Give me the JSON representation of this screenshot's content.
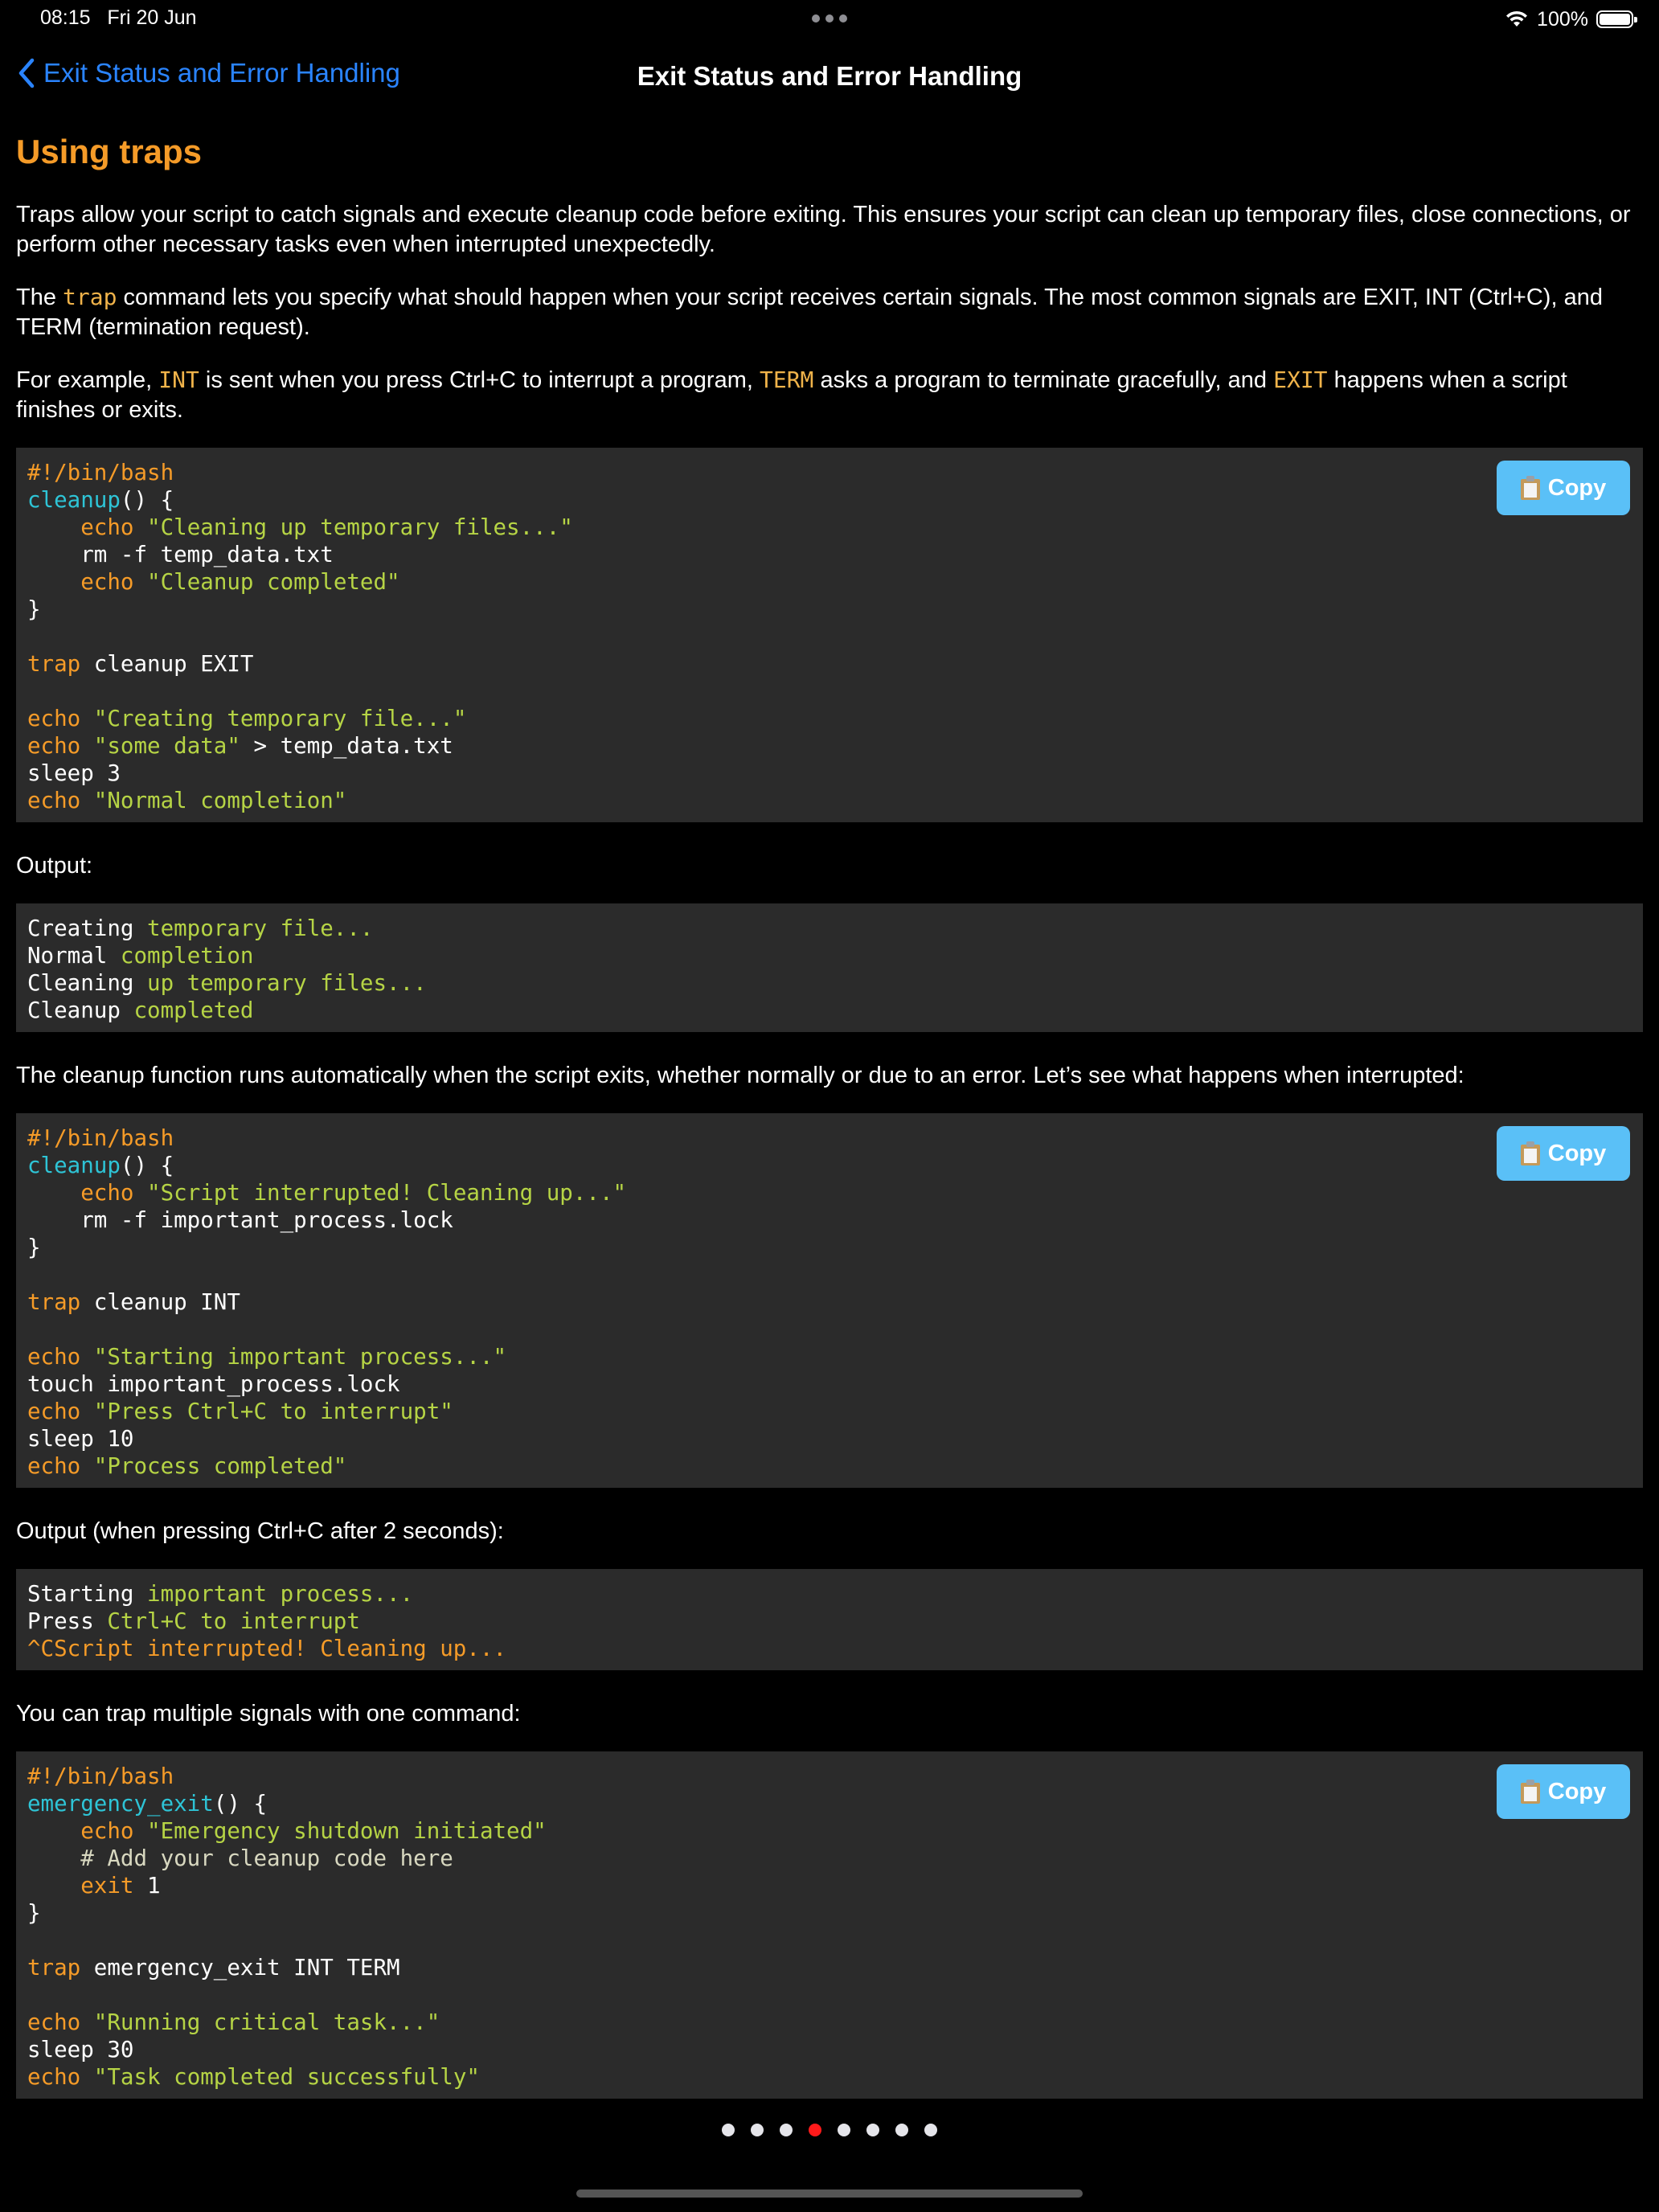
{
  "status_bar": {
    "time": "08:15",
    "date": "Fri 20 Jun",
    "battery": "100%",
    "battery_level": 1.0,
    "wifi_icon": "wifi-icon"
  },
  "nav": {
    "back_label": "Exit Status and Error Handling",
    "title": "Exit Status and Error Handling"
  },
  "content": {
    "section_title": "Using traps",
    "p1": "Traps allow your script to catch signals and execute cleanup code before exiting. This ensures your script can clean up temporary files, close connections, or perform other necessary tasks even when interrupted unexpectedly.",
    "p2": [
      {
        "text": "The ",
        "style": "plain"
      },
      {
        "text": "trap",
        "style": "kw"
      },
      {
        "text": " command lets you specify what should happen when your script receives certain signals. The most common signals are EXIT, INT (Ctrl+C), and TERM (termination request).",
        "style": "plain"
      }
    ],
    "p3": [
      {
        "text": "For example, ",
        "style": "plain"
      },
      {
        "text": "INT",
        "style": "kw"
      },
      {
        "text": " is sent when you press Ctrl+C to interrupt a program, ",
        "style": "plain"
      },
      {
        "text": "TERM",
        "style": "kw"
      },
      {
        "text": " asks a program to terminate gracefully, and ",
        "style": "plain"
      },
      {
        "text": "EXIT",
        "style": "kw"
      },
      {
        "text": " happens when a script finishes or exits.",
        "style": "plain"
      }
    ],
    "code1": [
      [
        {
          "t": "#!/bin/bash",
          "c": "orange"
        }
      ],
      [
        {
          "t": "cleanup",
          "c": "cyan"
        },
        {
          "t": "() {",
          "c": "white"
        }
      ],
      [
        {
          "t": "    ",
          "c": "white"
        },
        {
          "t": "echo",
          "c": "orange"
        },
        {
          "t": " ",
          "c": "white"
        },
        {
          "t": "\"Cleaning up temporary files...\"",
          "c": "green"
        }
      ],
      [
        {
          "t": "    rm -f temp_data.txt",
          "c": "white"
        }
      ],
      [
        {
          "t": "    ",
          "c": "white"
        },
        {
          "t": "echo",
          "c": "orange"
        },
        {
          "t": " ",
          "c": "white"
        },
        {
          "t": "\"Cleanup completed\"",
          "c": "green"
        }
      ],
      [
        {
          "t": "}",
          "c": "white"
        }
      ],
      [],
      [
        {
          "t": "trap",
          "c": "orange"
        },
        {
          "t": " cleanup EXIT",
          "c": "white"
        }
      ],
      [],
      [
        {
          "t": "echo",
          "c": "orange"
        },
        {
          "t": " ",
          "c": "white"
        },
        {
          "t": "\"Creating temporary file...\"",
          "c": "green"
        }
      ],
      [
        {
          "t": "echo",
          "c": "orange"
        },
        {
          "t": " ",
          "c": "white"
        },
        {
          "t": "\"some data\"",
          "c": "green"
        },
        {
          "t": " > temp_data.txt",
          "c": "white"
        }
      ],
      [
        {
          "t": "sleep 3",
          "c": "white"
        }
      ],
      [
        {
          "t": "echo",
          "c": "orange"
        },
        {
          "t": " ",
          "c": "white"
        },
        {
          "t": "\"Normal completion\"",
          "c": "green"
        }
      ]
    ],
    "output1_label": "Output:",
    "output1": [
      [
        {
          "t": "Creating ",
          "c": "white"
        },
        {
          "t": "temporary file...",
          "c": "green"
        }
      ],
      [
        {
          "t": "Normal ",
          "c": "white"
        },
        {
          "t": "completion",
          "c": "green"
        }
      ],
      [
        {
          "t": "Cleaning ",
          "c": "white"
        },
        {
          "t": "up temporary files...",
          "c": "green"
        }
      ],
      [
        {
          "t": "Cleanup ",
          "c": "white"
        },
        {
          "t": "completed",
          "c": "green"
        }
      ]
    ],
    "p4": "The cleanup function runs automatically when the script exits, whether normally or due to an error. Let’s see what happens when interrupted:",
    "code2": [
      [
        {
          "t": "#!/bin/bash",
          "c": "orange"
        }
      ],
      [
        {
          "t": "cleanup",
          "c": "cyan"
        },
        {
          "t": "() {",
          "c": "white"
        }
      ],
      [
        {
          "t": "    ",
          "c": "white"
        },
        {
          "t": "echo",
          "c": "orange"
        },
        {
          "t": " ",
          "c": "white"
        },
        {
          "t": "\"Script interrupted! Cleaning up...\"",
          "c": "green"
        }
      ],
      [
        {
          "t": "    rm -f important_process.lock",
          "c": "white"
        }
      ],
      [
        {
          "t": "}",
          "c": "white"
        }
      ],
      [],
      [
        {
          "t": "trap",
          "c": "orange"
        },
        {
          "t": " cleanup INT",
          "c": "white"
        }
      ],
      [],
      [
        {
          "t": "echo",
          "c": "orange"
        },
        {
          "t": " ",
          "c": "white"
        },
        {
          "t": "\"Starting important process...\"",
          "c": "green"
        }
      ],
      [
        {
          "t": "touch important_process.lock",
          "c": "white"
        }
      ],
      [
        {
          "t": "echo",
          "c": "orange"
        },
        {
          "t": " ",
          "c": "white"
        },
        {
          "t": "\"Press Ctrl+C to interrupt\"",
          "c": "green"
        }
      ],
      [
        {
          "t": "sleep 10",
          "c": "white"
        }
      ],
      [
        {
          "t": "echo",
          "c": "orange"
        },
        {
          "t": " ",
          "c": "white"
        },
        {
          "t": "\"Process completed\"",
          "c": "green"
        }
      ]
    ],
    "output2_label": "Output (when pressing Ctrl+C after 2 seconds):",
    "output2": [
      [
        {
          "t": "Starting ",
          "c": "white"
        },
        {
          "t": "important process...",
          "c": "green"
        }
      ],
      [
        {
          "t": "Press ",
          "c": "white"
        },
        {
          "t": "Ctrl+C to interrupt",
          "c": "green"
        }
      ],
      [
        {
          "t": "^CScript interrupted! Cleaning up...",
          "c": "orange"
        }
      ]
    ],
    "p5": "You can trap multiple signals with one command:",
    "code3": [
      [
        {
          "t": "#!/bin/bash",
          "c": "orange"
        }
      ],
      [
        {
          "t": "emergency_exit",
          "c": "cyan"
        },
        {
          "t": "() {",
          "c": "white"
        }
      ],
      [
        {
          "t": "    ",
          "c": "white"
        },
        {
          "t": "echo",
          "c": "orange"
        },
        {
          "t": " ",
          "c": "white"
        },
        {
          "t": "\"Emergency shutdown initiated\"",
          "c": "green"
        }
      ],
      [
        {
          "t": "    # Add your cleanup code here",
          "c": "comment"
        }
      ],
      [
        {
          "t": "    ",
          "c": "white"
        },
        {
          "t": "exit",
          "c": "orange"
        },
        {
          "t": " 1",
          "c": "white"
        }
      ],
      [
        {
          "t": "}",
          "c": "white"
        }
      ],
      [],
      [
        {
          "t": "trap",
          "c": "orange"
        },
        {
          "t": " emergency_exit INT TERM",
          "c": "white"
        }
      ],
      [],
      [
        {
          "t": "echo",
          "c": "orange"
        },
        {
          "t": " ",
          "c": "white"
        },
        {
          "t": "\"Running critical task...\"",
          "c": "green"
        }
      ],
      [
        {
          "t": "sleep 30",
          "c": "white"
        }
      ],
      [
        {
          "t": "echo",
          "c": "orange"
        },
        {
          "t": " ",
          "c": "white"
        },
        {
          "t": "\"Task completed successfully\"",
          "c": "green"
        }
      ]
    ],
    "copy_label": "Copy"
  },
  "pager": {
    "count": 8,
    "active_index": 3
  },
  "colors": {
    "accent_blue": "#2a84ff",
    "title_orange": "#f59b28",
    "copy_button": "#5ac0f7",
    "code_bg": "#2b2b2b",
    "active_dot": "#ff1a1a"
  }
}
